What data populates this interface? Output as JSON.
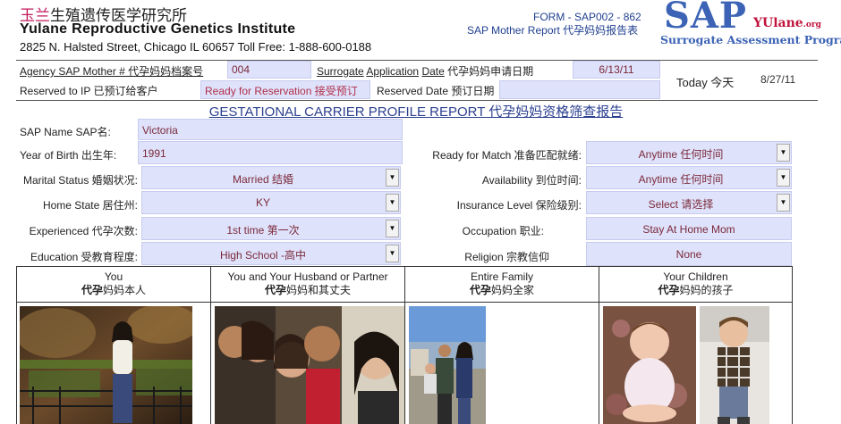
{
  "header": {
    "institute_cn_pink": "玉兰",
    "institute_cn_rest": "生殖遗传医学研究所",
    "institute_en": "Yulane Reproductive Genetics Institute",
    "address": "2825 N. Halsted Street, Chicago IL 60657  Toll Free: 1-888-600-0188",
    "form_number": "FORM - SAP002 - 862",
    "form_title": "SAP Mother Report 代孕妈妈报告表",
    "logo_sap": "SAP",
    "logo_yulane": "YUlane",
    "logo_org": ".org",
    "logo_tagline": "Surrogate Assessment Program"
  },
  "agency": {
    "agency_label": "Agency SAP Mother # 代孕妈妈档案号",
    "agency_value": "004",
    "surrogate_label_1": "Surrogate",
    "surrogate_label_2": "Application",
    "surrogate_label_3": "Date",
    "surrogate_label_cn": "代孕妈妈申请日期",
    "surrogate_date": "6/13/11",
    "reserved_ip_label": "Reserved to IP  已预订给客户",
    "reservation_status": "Ready for Reservation 接受预订",
    "reserved_date_label": "Reserved Date 预订日期",
    "reserved_date_value": "",
    "today_label": "Today 今天",
    "today_value": "8/27/11"
  },
  "report_title": "GESTATIONAL CARRIER PROFILE REPORT 代孕妈妈资格筛查报告",
  "profile": {
    "name_label": "SAP Name SAP名:",
    "name_value": "Victoria",
    "birth_label": "Year of Birth 出生年:",
    "birth_value": "1991",
    "marital_label": "Marital Status 婚姻状况:",
    "marital_value": "Married 结婚",
    "state_label": "Home State 居住州:",
    "state_value": "KY",
    "experience_label": "Experienced  代孕次数:",
    "experience_value": "1st time   第一次",
    "education_label": "Education 受教育程度:",
    "education_value": "High School -高中",
    "ready_label": "Ready for Match 准备匹配就绪:",
    "ready_value": "Anytime 任何时间",
    "availability_label": "Availability 到位时间:",
    "availability_value": "Anytime 任何时间",
    "insurance_label": "Insurance Level 保险级别:",
    "insurance_value": "Select 请选择",
    "occupation_label": "Occupation  职业:",
    "occupation_value": "Stay At Home Mom",
    "religion_label": "Religion 宗教信仰",
    "religion_value": "None"
  },
  "photos": [
    {
      "title_en": "You",
      "title_cn_bold": "代孕",
      "title_cn_rest": "妈妈本人"
    },
    {
      "title_en": "You and Your Husband or Partner",
      "title_cn_bold": "代孕",
      "title_cn_rest": "妈妈和其丈夫"
    },
    {
      "title_en": "Entire Family",
      "title_cn_bold": "代孕",
      "title_cn_rest": "妈妈全家"
    },
    {
      "title_en": "Your Children",
      "title_cn_bold": "代孕",
      "title_cn_rest": "妈妈的孩子"
    }
  ],
  "colors": {
    "field_bg": "#dfe2fb",
    "field_text": "#7a2a3a",
    "title_blue": "#2a3f8f",
    "logo_blue": "#3c63b5",
    "logo_red": "#c0143c"
  }
}
